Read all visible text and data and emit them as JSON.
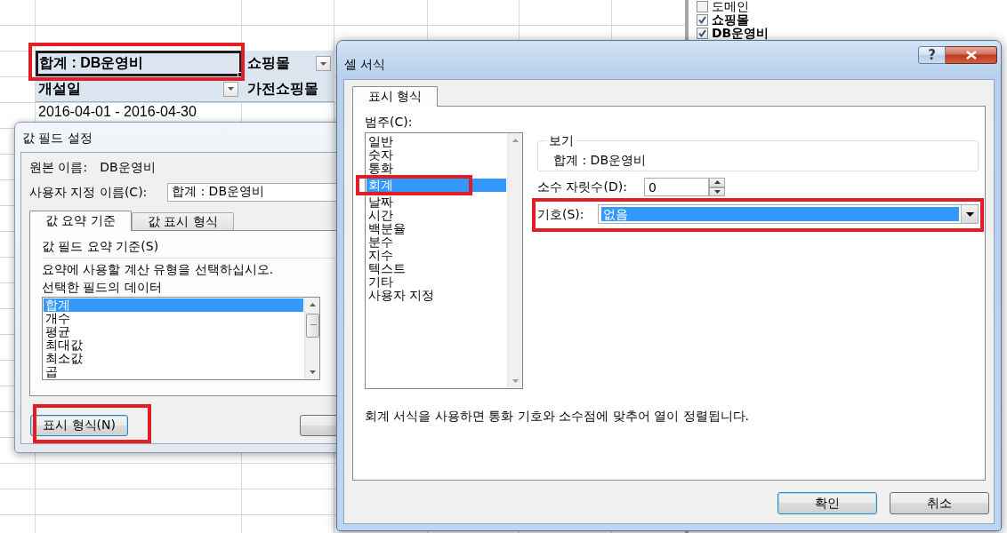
{
  "spreadsheet": {
    "pivot_table": {
      "value_field": {
        "text": "합계 : DB운영비",
        "selected": true,
        "highlighted": true
      },
      "column_field": "쇼핑몰",
      "row_field": "개설일",
      "column_items": [
        "가전쇼핑몰"
      ],
      "row_items": [
        "2016-04-01 - 2016-04-30"
      ]
    }
  },
  "field_list": {
    "fields": [
      {
        "label": "도메인",
        "checked": false
      },
      {
        "label": "쇼핑몰",
        "checked": true
      },
      {
        "label": "DB운영비",
        "checked": true
      }
    ]
  },
  "value_field_settings_dialog": {
    "title": "값 필드 설정",
    "source_name": {
      "label": "원본 이름:",
      "value": "DB운영비"
    },
    "custom_name": {
      "label": "사용자 지정 이름(C):",
      "value": "합계 : DB운영비"
    },
    "tabs": [
      {
        "label": "값 요약 기준",
        "selected": true
      },
      {
        "label": "값 표시 형식",
        "selected": false
      }
    ],
    "section_label": "값 필드 요약 기준(S)",
    "instructions": [
      "요약에 사용할 계산 유형을 선택하십시오.",
      "선택한 필드의 데이터"
    ],
    "functions": [
      {
        "label": "합계",
        "selected": true
      },
      {
        "label": "개수",
        "selected": false
      },
      {
        "label": "평균",
        "selected": false
      },
      {
        "label": "최대값",
        "selected": false
      },
      {
        "label": "최소값",
        "selected": false
      },
      {
        "label": "곱",
        "selected": false
      }
    ],
    "number_format_button": {
      "label": "표시 형식(N)",
      "default": true,
      "highlighted": true
    }
  },
  "format_cells_dialog": {
    "title": "셀 서식",
    "help_button": "?",
    "tabs": [
      {
        "label": "표시 형식",
        "selected": true
      }
    ],
    "category": {
      "label": "범주(C):",
      "items": [
        {
          "label": "일반",
          "selected": false,
          "highlighted": false
        },
        {
          "label": "숫자",
          "selected": false,
          "highlighted": false
        },
        {
          "label": "통화",
          "selected": false,
          "highlighted": false
        },
        {
          "label": "회계",
          "selected": true,
          "highlighted": true
        },
        {
          "label": "날짜",
          "selected": false,
          "highlighted": false
        },
        {
          "label": "시간",
          "selected": false,
          "highlighted": false
        },
        {
          "label": "백분율",
          "selected": false,
          "highlighted": false
        },
        {
          "label": "분수",
          "selected": false,
          "highlighted": false
        },
        {
          "label": "지수",
          "selected": false,
          "highlighted": false
        },
        {
          "label": "텍스트",
          "selected": false,
          "highlighted": false
        },
        {
          "label": "기타",
          "selected": false,
          "highlighted": false
        },
        {
          "label": "사용자 지정",
          "selected": false,
          "highlighted": false
        }
      ]
    },
    "sample": {
      "label": "보기",
      "value": "합계 : DB운영비"
    },
    "decimal_places": {
      "label": "소수 자릿수(D):",
      "value": "0"
    },
    "symbol": {
      "label": "기호(S):",
      "value": "없음",
      "highlighted": true
    },
    "description": "회계 서식을 사용하면 통화 기호와 소수점에 맞추어 열이 정렬됩니다.",
    "buttons": [
      {
        "label": "확인",
        "default": true
      },
      {
        "label": "취소",
        "default": false
      }
    ]
  }
}
